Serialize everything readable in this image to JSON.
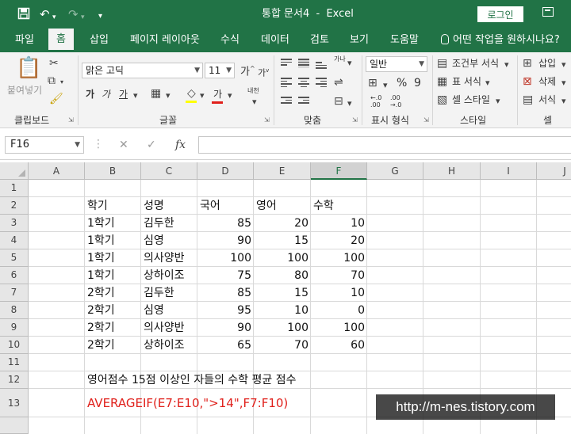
{
  "window": {
    "title": "통합 문서4  -  Excel",
    "login_label": "로그인",
    "accent_color": "#217346"
  },
  "quick_access": {
    "save_icon": "save-icon",
    "undo_icon": "undo-icon",
    "redo_icon": "redo-icon",
    "customize_icon": "customize-qat-icon"
  },
  "tabs": [
    {
      "label": "파일",
      "active": false
    },
    {
      "label": "홈",
      "active": true
    },
    {
      "label": "삽입",
      "active": false
    },
    {
      "label": "페이지 레이아웃",
      "active": false
    },
    {
      "label": "수식",
      "active": false
    },
    {
      "label": "데이터",
      "active": false
    },
    {
      "label": "검토",
      "active": false
    },
    {
      "label": "보기",
      "active": false
    },
    {
      "label": "도움말",
      "active": false
    }
  ],
  "tell_me": "어떤 작업을 원하시나요?",
  "ribbon": {
    "clipboard": {
      "paste_label": "붙여넣기",
      "group": "클립보드"
    },
    "font": {
      "name": "맑은 고딕",
      "size": "11",
      "group": "글꼴",
      "bold": "가",
      "italic": "가",
      "underline": "가",
      "font_color": "가",
      "phonetic": "내천"
    },
    "alignment": {
      "group": "맞춤",
      "wrap": "가나"
    },
    "number": {
      "format": "일반",
      "group": "표시 형식",
      "percent": "%",
      "comma": "9"
    },
    "styles": {
      "conditional": "조건부 서식",
      "table": "표 서식",
      "cell_styles": "셀 스타일",
      "group": "스타일"
    },
    "cells": {
      "insert": "삽입",
      "delete": "삭제",
      "format": "서식",
      "group": "셀"
    }
  },
  "formula_bar": {
    "name_box": "F16",
    "cancel": "✕",
    "enter": "✓",
    "fx": "fx",
    "content": ""
  },
  "sheet": {
    "columns": [
      "A",
      "B",
      "C",
      "D",
      "E",
      "F",
      "G",
      "H",
      "I",
      "J"
    ],
    "selected_column": "F",
    "rows": [
      "1",
      "2",
      "3",
      "4",
      "5",
      "6",
      "7",
      "8",
      "9",
      "10",
      "11",
      "12",
      "13",
      ""
    ],
    "header": [
      "학기",
      "성명",
      "국어",
      "영어",
      "수학"
    ],
    "data": [
      [
        "1학기",
        "김두한",
        "85",
        "20",
        "10"
      ],
      [
        "1학기",
        "심영",
        "90",
        "15",
        "20"
      ],
      [
        "1학기",
        "의사양반",
        "100",
        "100",
        "100"
      ],
      [
        "1학기",
        "상하이조",
        "75",
        "80",
        "70"
      ],
      [
        "2학기",
        "김두한",
        "85",
        "15",
        "10"
      ],
      [
        "2학기",
        "심영",
        "95",
        "10",
        "0"
      ],
      [
        "2학기",
        "의사양반",
        "90",
        "100",
        "100"
      ],
      [
        "2학기",
        "상하이조",
        "65",
        "70",
        "60"
      ]
    ],
    "note": "영어점수 15점 이상인 자들의 수학 평균 점수",
    "formula": "AVERAGEIF(E7:E10,\">14\",F7:F10)",
    "formula_color": "#e0201b"
  },
  "watermark": "http://m-nes.tistory.com"
}
